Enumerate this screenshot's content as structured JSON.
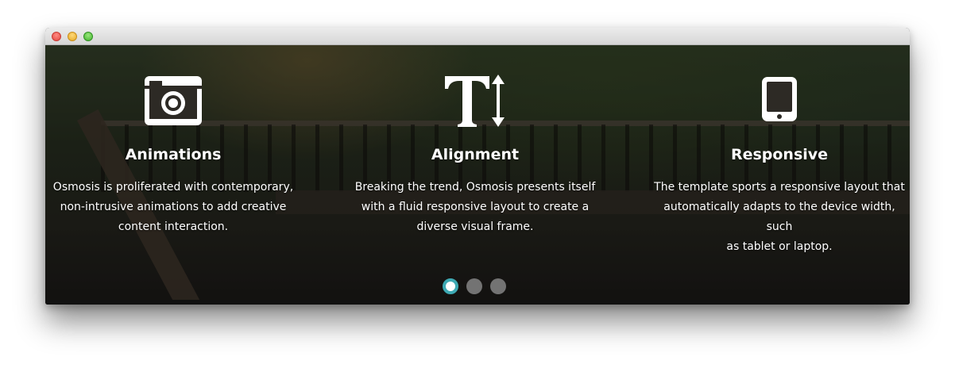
{
  "window": {
    "controls": [
      "close",
      "minimize",
      "maximize"
    ]
  },
  "features": [
    {
      "icon": "camera-icon",
      "title": "Animations",
      "lines": [
        "Osmosis is proliferated with contemporary,",
        "non-intrusive animations to add creative",
        "content interaction."
      ]
    },
    {
      "icon": "text-height-icon",
      "title": "Alignment",
      "lines": [
        "Breaking the trend, Osmosis presents itself",
        "with a fluid responsive layout to create a",
        "diverse visual frame."
      ]
    },
    {
      "icon": "tablet-icon",
      "title": "Responsive",
      "lines": [
        "The template sports a responsive layout that",
        "automatically adapts to the device width, such",
        "as tablet or laptop."
      ]
    }
  ],
  "slider": {
    "count": 3,
    "active_index": 0
  },
  "colors": {
    "accent": "#3da9b3",
    "dot_inactive": "#737373",
    "text": "#ffffff"
  }
}
